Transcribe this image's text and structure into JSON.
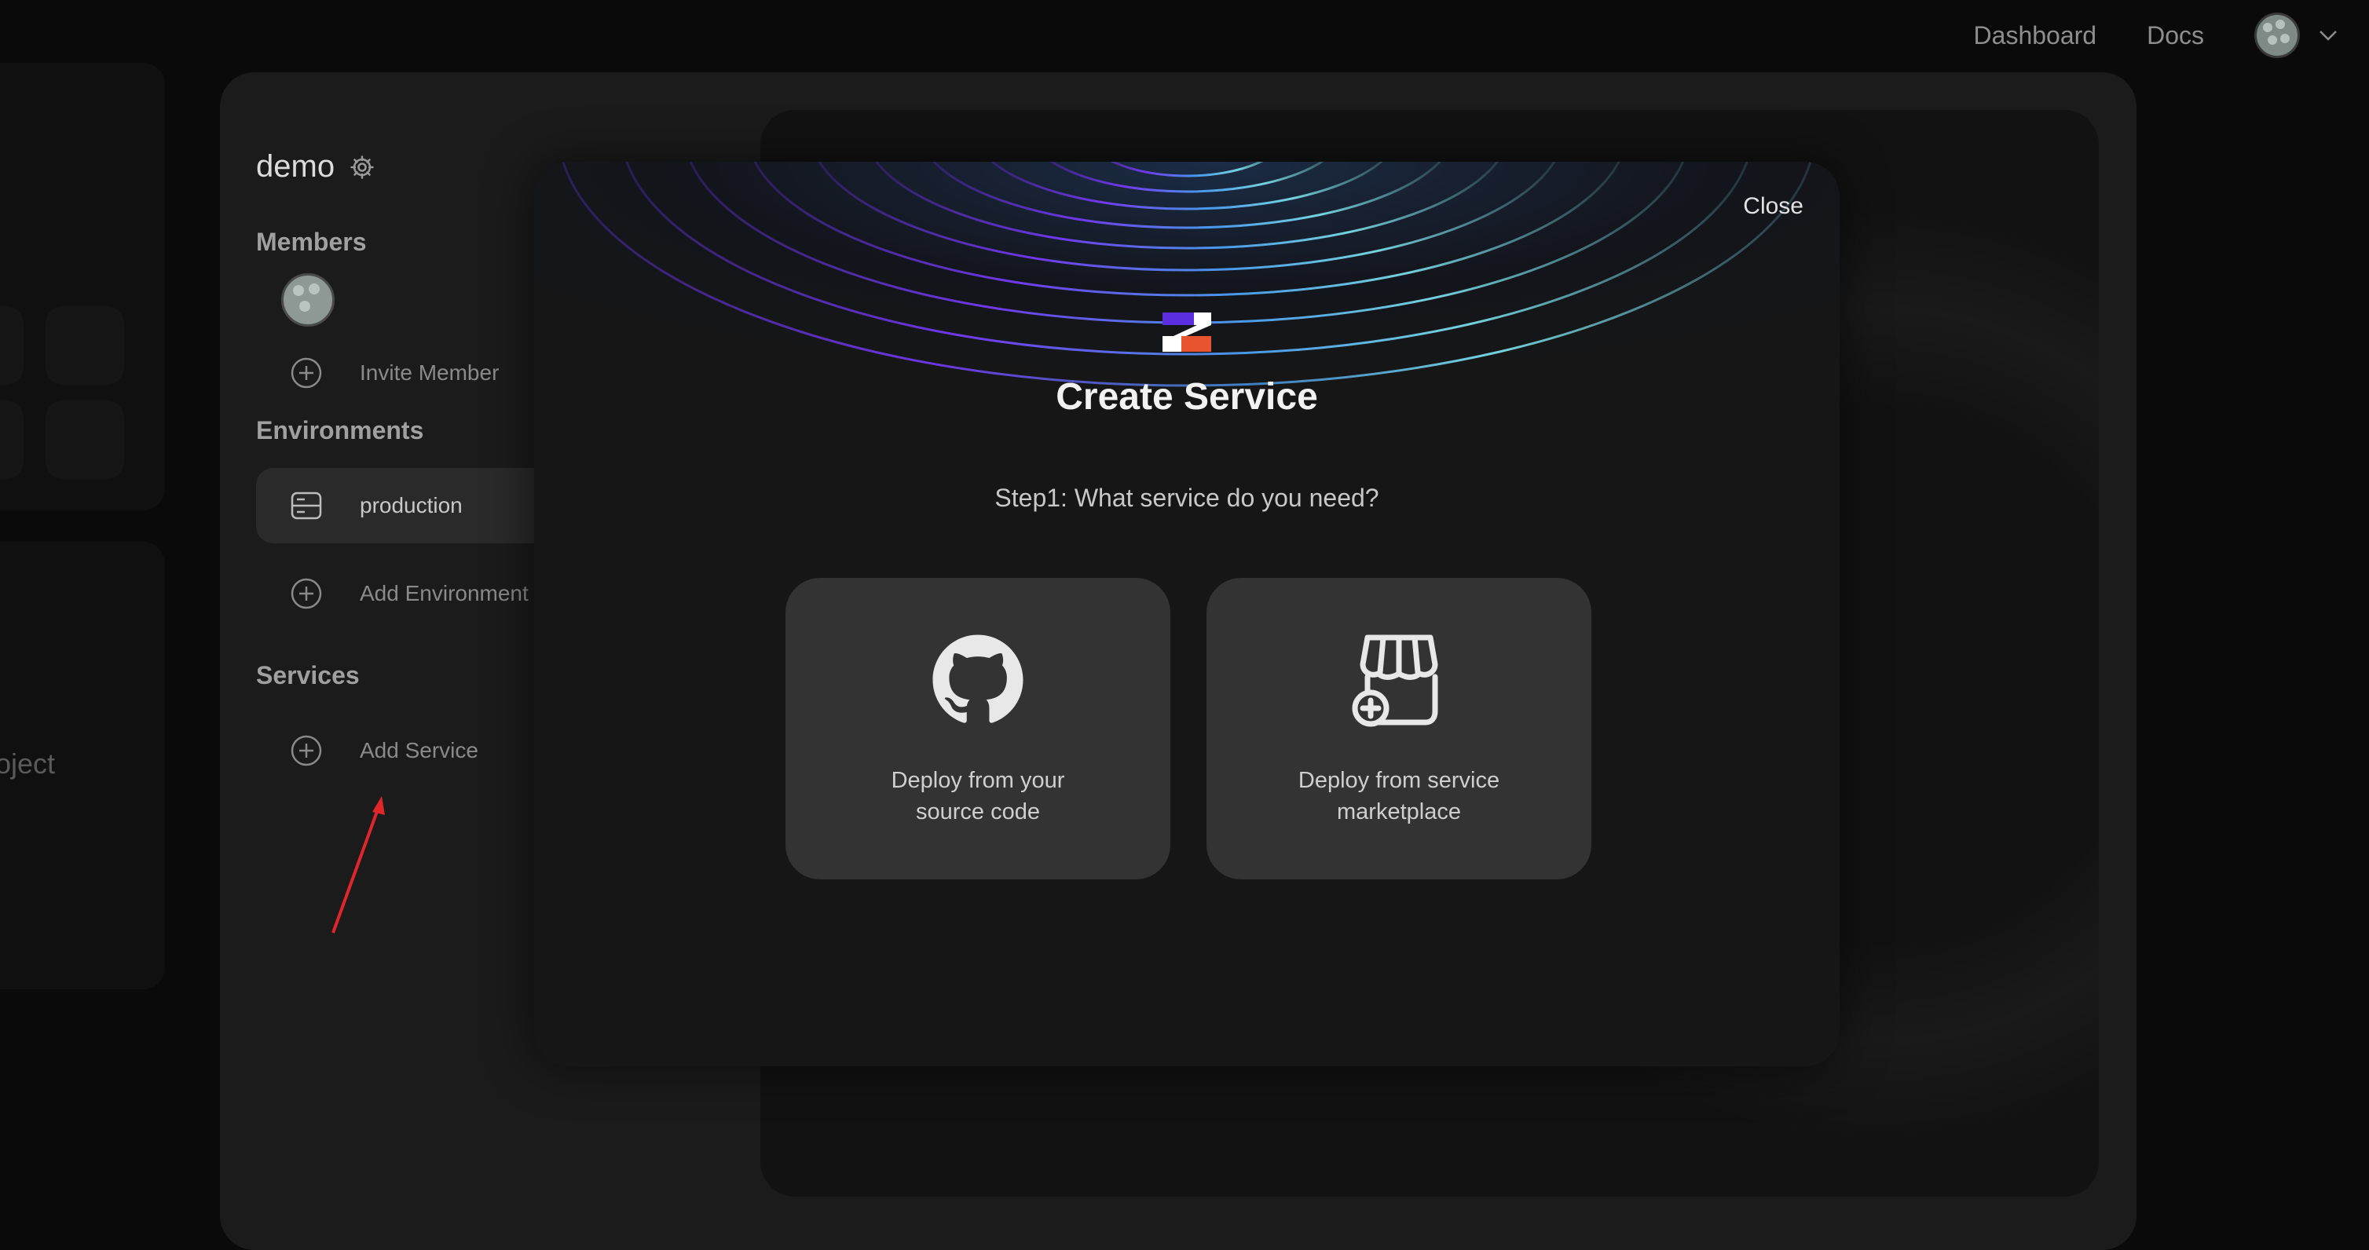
{
  "topnav": {
    "dashboard": "Dashboard",
    "docs": "Docs"
  },
  "background": {
    "project_partial": "oject"
  },
  "sidebar": {
    "project_name": "demo",
    "members_heading": "Members",
    "invite_member": "Invite Member",
    "environments_heading": "Environments",
    "environment_name": "production",
    "add_environment": "Add Environment",
    "services_heading": "Services",
    "add_service": "Add Service"
  },
  "modal": {
    "close": "Close",
    "title": "Create Service",
    "step": "Step1: What service do you need?",
    "options": [
      {
        "label": "Deploy from your\nsource code",
        "icon": "github-icon"
      },
      {
        "label": "Deploy from service\nmarketplace",
        "icon": "marketplace-icon"
      }
    ]
  },
  "colors": {
    "annotation_arrow": "#e0262b",
    "logo_purple": "#5b2ee0",
    "logo_orange": "#e8542f"
  }
}
